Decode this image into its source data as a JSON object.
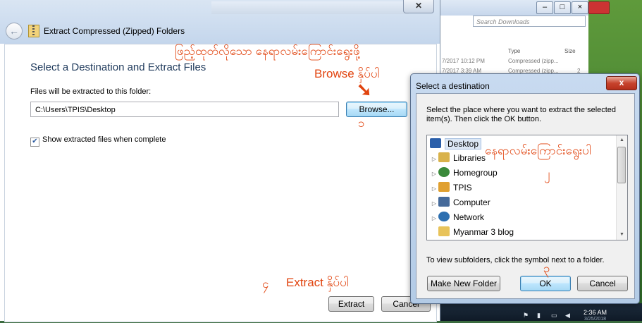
{
  "background": {
    "explorer_search_placeholder": "Search Downloads",
    "explorer_columns": [
      "Type",
      "Size"
    ],
    "explorer_rows": [
      {
        "date": "7/2017 10:12 PM",
        "type": "Compressed (zipp..."
      },
      {
        "date": "7/2017 3:39 AM",
        "type": "Compressed (zipp...",
        "size": "2"
      }
    ],
    "clock_time": "2:36 AM",
    "clock_date": "3/25/2018"
  },
  "main_dialog": {
    "title": "Extract Compressed (Zipped) Folders",
    "heading": "Select a Destination and Extract Files",
    "folder_label": "Files will be extracted to this folder:",
    "path_value": "C:\\Users\\TPIS\\Desktop",
    "browse_label": "Browse...",
    "show_files_label": "Show extracted files when complete",
    "show_files_checked": true,
    "extract_label": "Extract",
    "cancel_label": "Cancel"
  },
  "annotations": {
    "choose_location": "ဖြည့်ထုတ်လိုသော နေရာလမ်းကြောင်းရွေးဖို့",
    "browse_hint": "Browse နှိပ်ပါ",
    "step1": "၁",
    "choose_here": "နေရာလမ်းကြောင်းရွေးပါ",
    "step2": "၂",
    "step3": "၃",
    "step4": "၄",
    "extract_hint": "Extract နှိပ်ပါ"
  },
  "destination_dialog": {
    "title": "Select a destination",
    "close_label": "x",
    "instructions": "Select the place where you want to extract the selected item(s).  Then click the OK button.",
    "tree_items": [
      {
        "label": "Desktop",
        "icon": "desktop-icon",
        "color": "#2b5faa"
      },
      {
        "label": "Libraries",
        "icon": "libraries-icon",
        "color": "#d9b24a"
      },
      {
        "label": "Homegroup",
        "icon": "homegroup-icon",
        "color": "#3a8a3a"
      },
      {
        "label": "TPIS",
        "icon": "user-folder-icon",
        "color": "#e0a030"
      },
      {
        "label": "Computer",
        "icon": "computer-icon",
        "color": "#456a9a"
      },
      {
        "label": "Network",
        "icon": "network-icon",
        "color": "#2d6fb0"
      },
      {
        "label": "Myanmar 3 blog",
        "icon": "folder-icon",
        "color": "#e8c35a"
      }
    ],
    "hint": "To view subfolders, click the symbol next to a folder.",
    "make_folder_label": "Make New Folder",
    "ok_label": "OK",
    "cancel_label": "Cancel"
  },
  "colors": {
    "annotation": "#e1440f",
    "heading": "#1e395b",
    "selection": "#dde8f5"
  }
}
